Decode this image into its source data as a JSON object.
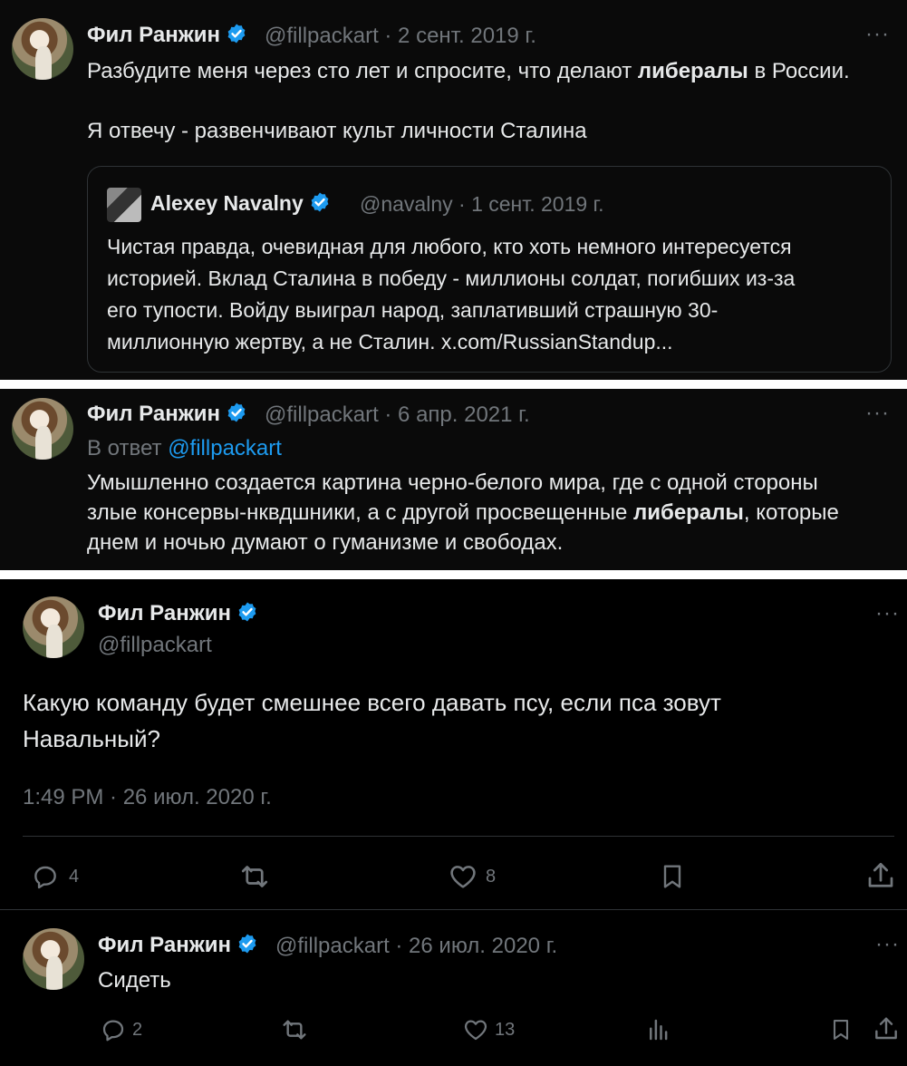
{
  "tweet1": {
    "name": "Фил Ранжин",
    "handle_date": "@fillpackart · 2 сент. 2019 г.",
    "more": "···",
    "text_before": "Разбудите меня через сто лет и спросите, что делают ",
    "text_bold": "либералы",
    "text_after": " в России.",
    "text_line2": "Я отвечу - развенчивают культ личности Сталина",
    "quote": {
      "name": "Alexey Navalny",
      "handle_date": "@navalny · 1 сент. 2019 г.",
      "line1": "Чистая правда, очевидная для любого, кто хоть немного интересуется",
      "line2": "историей. Вклад Сталина в победу - миллионы солдат, погибших из-за",
      "line3": "его тупости. Войду выиграл народ, заплативший страшную 30-",
      "line4": "миллионную жертву, а не Сталин. x.com/RussianStandup..."
    }
  },
  "tweet2": {
    "name": "Фил Ранжин",
    "handle_date": "@fillpackart · 6 апр. 2021 г.",
    "more": "···",
    "reply_prefix": "В ответ ",
    "reply_handle": "@fillpackart",
    "line1": "Умышленно создается картина черно-белого мира, где с одной стороны",
    "line2_before": "злые консервы-нквдшники, а с другой просвещенные ",
    "line2_bold": "либералы",
    "line2_after": ", которые",
    "line3": "днем и ночью думают о гуманизме и свободах."
  },
  "tweet3": {
    "name": "Фил Ранжин",
    "handle": "@fillpackart",
    "more": "···",
    "line1": "Какую команду будет смешнее всего давать псу, если пса зовут",
    "line2": "Навальный?",
    "timestamp": "1:49 PM · 26 июл. 2020 г.",
    "replies": "4",
    "likes": "8"
  },
  "reply": {
    "name": "Фил Ранжин",
    "handle_date": "@fillpackart · 26 июл. 2020 г.",
    "more": "···",
    "text": "Сидеть",
    "replies": "2",
    "likes": "13"
  },
  "colors": {
    "background": "#000000",
    "panel_bg": "#0a0a0a",
    "separator": "#ffffff",
    "text": "#e7e9ea",
    "muted": "#71767b",
    "link": "#1d9bf0",
    "verified": "#1d9bf0"
  }
}
